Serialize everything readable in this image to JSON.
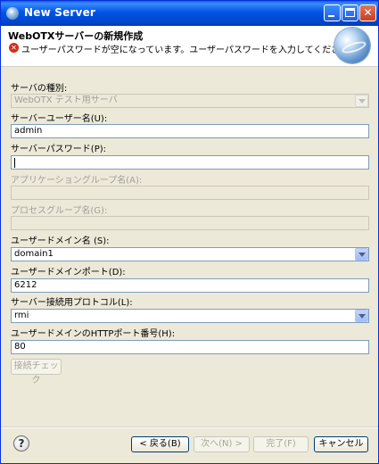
{
  "window": {
    "title": "New Server"
  },
  "header": {
    "title": "WebOTXサーバーの新規作成",
    "message": "ユーザーパスワードが空になっています。ユーザーパスワードを入力してください。"
  },
  "form": {
    "server_type": {
      "label": "サーバの種別:",
      "value": "WebOTX テスト用サーバ"
    },
    "server_user": {
      "label": "サーバーユーザー名(U):",
      "value": "admin"
    },
    "server_password": {
      "label": "サーバーパスワード(P):",
      "value": ""
    },
    "app_group": {
      "label": "アプリケーショングループ名(A):",
      "value": ""
    },
    "process_group": {
      "label": "プロセスグループ名(G):",
      "value": ""
    },
    "user_domain": {
      "label": "ユーザードメイン名 (S):",
      "value": "domain1"
    },
    "domain_port": {
      "label": "ユーザードメインポート(D):",
      "value": "6212"
    },
    "protocol": {
      "label": "サーバー接続用プロトコル(L):",
      "value": "rmi"
    },
    "http_port": {
      "label": "ユーザードメインのHTTPポート番号(H):",
      "value": "80"
    },
    "check_button": "接続チェック"
  },
  "footer": {
    "back": "< 戻る(B)",
    "next": "次へ(N) >",
    "finish": "完了(F)",
    "cancel": "キャンセル"
  },
  "icons": {
    "title": "eclipse-icon",
    "error": "error-icon",
    "wizard": "server-globe-icon",
    "help": "help-icon"
  }
}
